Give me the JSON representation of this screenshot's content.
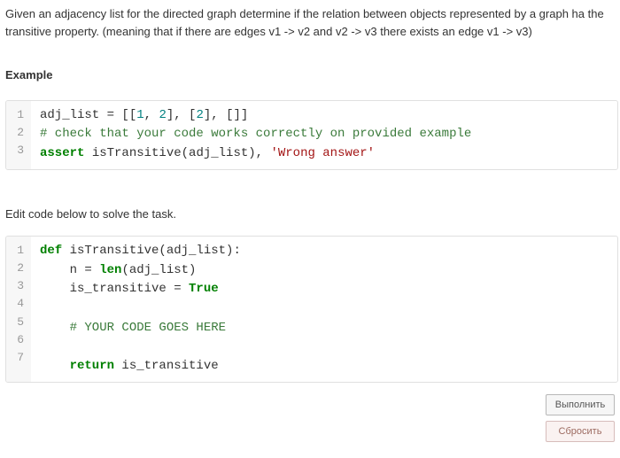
{
  "description": "Given an adjacency list for the directed graph determine if the relation between objects represented by a graph ha the transitive property. (meaning that if there are edges v1 -> v2 and v2 -> v3 there exists an edge v1 -> v3)",
  "sections": {
    "example_title": "Example",
    "edit_prompt": "Edit code below to solve the task."
  },
  "code_block_1": {
    "lines": [
      "1",
      "2",
      "3"
    ],
    "l1_a": "adj_list = [[",
    "l1_n1": "1",
    "l1_b": ", ",
    "l1_n2": "2",
    "l1_c": "], [",
    "l1_n3": "2",
    "l1_d": "], []]",
    "l2_comment": "# check that your code works correctly on provided example",
    "l3_kw": "assert",
    "l3_mid": " isTransitive(adj_list), ",
    "l3_str": "'Wrong answer'"
  },
  "code_block_2": {
    "lines": [
      "1",
      "2",
      "3",
      "4",
      "5",
      "6",
      "7"
    ],
    "l1_def": "def",
    "l1_sig": " isTransitive(adj_list):",
    "l2_a": "    n = ",
    "l2_len": "len",
    "l2_b": "(adj_list)",
    "l3_a": "    is_transitive = ",
    "l3_true": "True",
    "l4": "",
    "l5_comment": "    # YOUR CODE GOES HERE",
    "l6": "",
    "l7_ret": "    return",
    "l7_tail": " is_transitive"
  },
  "buttons": {
    "run": "Выполнить",
    "reset": "Сбросить"
  }
}
